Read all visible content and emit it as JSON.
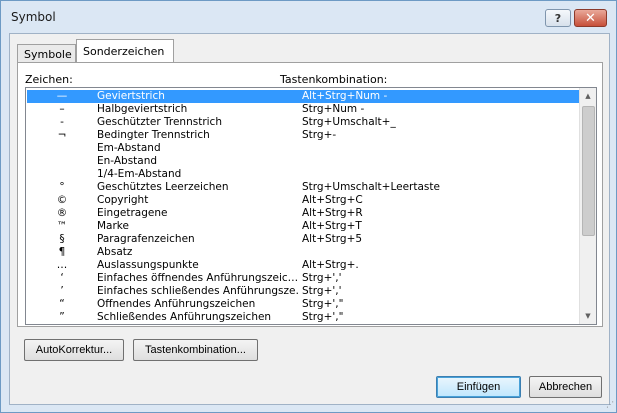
{
  "window": {
    "title": "Symbol",
    "help_label": "?",
    "close_label": "✕"
  },
  "tabs": [
    {
      "label": "Symbole",
      "active": false
    },
    {
      "label": "Sonderzeichen",
      "active": true
    }
  ],
  "columns": {
    "char_label": "Zeichen:",
    "shortcut_label": "Tastenkombination:"
  },
  "rows": [
    {
      "char": "—",
      "name": "Geviertstrich",
      "shortcut": "Alt+Strg+Num -",
      "selected": true
    },
    {
      "char": "–",
      "name": "Halbgeviertstrich",
      "shortcut": "Strg+Num -"
    },
    {
      "char": "-",
      "name": "Geschützter Trennstrich",
      "shortcut": "Strg+Umschalt+_"
    },
    {
      "char": "¬",
      "name": "Bedingter Trennstrich",
      "shortcut": "Strg+-"
    },
    {
      "char": "",
      "name": "Em-Abstand",
      "shortcut": ""
    },
    {
      "char": "",
      "name": "En-Abstand",
      "shortcut": ""
    },
    {
      "char": "",
      "name": "1/4-Em-Abstand",
      "shortcut": ""
    },
    {
      "char": "°",
      "name": "Geschütztes Leerzeichen",
      "shortcut": "Strg+Umschalt+Leertaste"
    },
    {
      "char": "©",
      "name": "Copyright",
      "shortcut": "Alt+Strg+C"
    },
    {
      "char": "®",
      "name": "Eingetragene",
      "shortcut": "Alt+Strg+R"
    },
    {
      "char": "™",
      "name": "Marke",
      "shortcut": "Alt+Strg+T"
    },
    {
      "char": "§",
      "name": "Paragrafenzeichen",
      "shortcut": "Alt+Strg+5"
    },
    {
      "char": "¶",
      "name": "Absatz",
      "shortcut": ""
    },
    {
      "char": "…",
      "name": "Auslassungspunkte",
      "shortcut": "Alt+Strg+."
    },
    {
      "char": "‘",
      "name": "Einfaches öffnendes Anführungszeic…",
      "shortcut": "Strg+',' "
    },
    {
      "char": "’",
      "name": "Einfaches schließendes Anführungsze…",
      "shortcut": "Strg+','"
    },
    {
      "char": "“",
      "name": "Öffnendes Anführungszeichen",
      "shortcut": "Strg+',\""
    },
    {
      "char": "”",
      "name": "Schließendes Anführungszeichen",
      "shortcut": "Strg+',\""
    }
  ],
  "buttons": {
    "autokorrektur": "AutoKorrektur...",
    "tastenkombination": "Tastenkombination...",
    "einfuegen": "Einfügen",
    "abbrechen": "Abbrechen"
  },
  "icons": {
    "scroll_up": "▲",
    "scroll_down": "▼",
    "resize_grip": "⋰"
  }
}
